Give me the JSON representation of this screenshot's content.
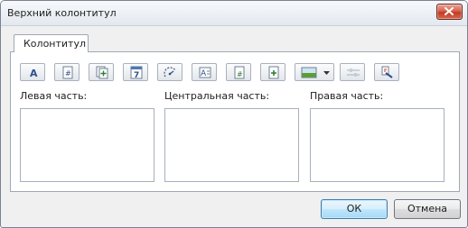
{
  "window": {
    "title": "Верхний колонтитул"
  },
  "tabs": [
    {
      "label": "Колонтитул"
    }
  ],
  "toolbar": {
    "buttons": [
      {
        "icon": "font-icon"
      },
      {
        "icon": "page-number-icon"
      },
      {
        "icon": "page-count-icon"
      },
      {
        "icon": "date-icon"
      },
      {
        "icon": "time-icon"
      },
      {
        "icon": "sheet-name-icon"
      },
      {
        "icon": "file-path-icon"
      },
      {
        "icon": "file-name-icon"
      },
      {
        "icon": "picture-icon"
      },
      {
        "icon": "format-picture-icon",
        "disabled": true
      },
      {
        "icon": "hyperlink-icon"
      }
    ]
  },
  "sections": {
    "left": {
      "label": "Левая часть:",
      "value": ""
    },
    "center": {
      "label": "Центральная часть:",
      "value": ""
    },
    "right": {
      "label": "Правая часть:",
      "value": ""
    }
  },
  "footer": {
    "ok_label": "ОК",
    "cancel_label": "Отмена"
  }
}
